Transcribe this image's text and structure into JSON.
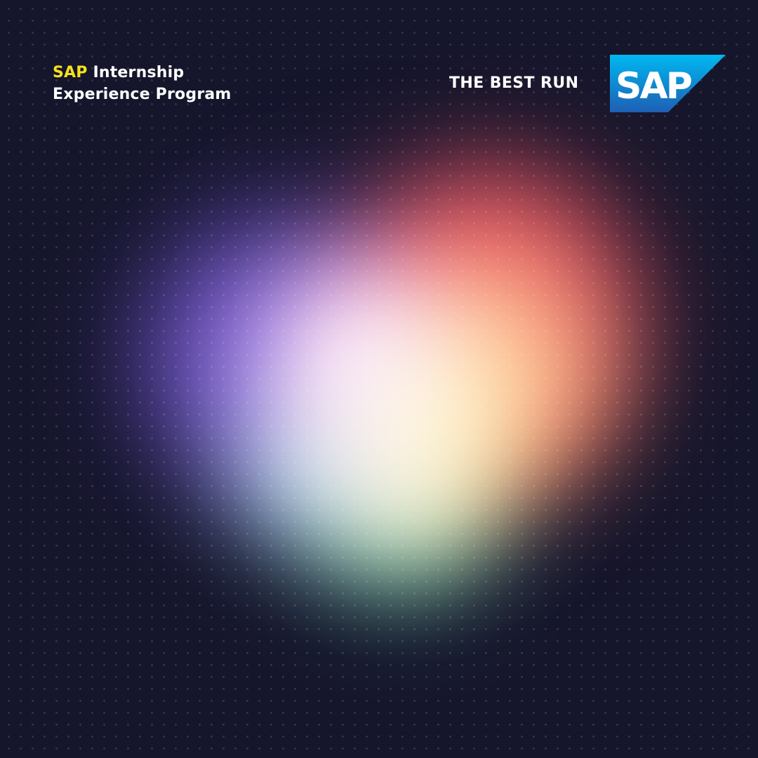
{
  "header": {
    "title_accent": "SAP",
    "title_rest": " Internship",
    "title_line2": "Experience Program",
    "tagline": "THE BEST RUN"
  },
  "logo": {
    "text": "SAP",
    "fill_top": "#00b8f1",
    "fill_bottom": "#1e5fb4",
    "text_color": "#ffffff"
  },
  "colors": {
    "background": "#15152b",
    "accent_yellow": "#f5e21c",
    "text": "#ffffff"
  }
}
